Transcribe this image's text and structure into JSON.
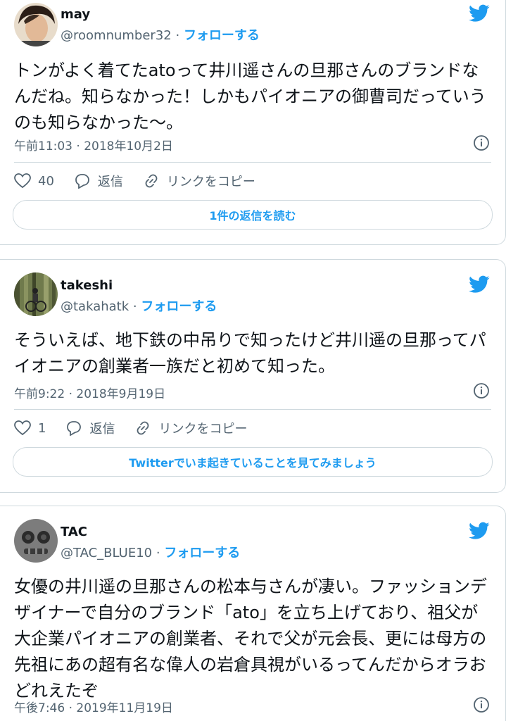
{
  "colors": {
    "accent": "#1d9bf0",
    "muted": "#536471",
    "border": "#cfd9de"
  },
  "tweets": [
    {
      "name": "may",
      "handle": "@roomnumber32",
      "dot": "·",
      "follow": "フォローする",
      "text": "トンがよく着てたatoって井川遥さんの旦那さんのブランドなんだね。知らなかった！しかもパイオニアの御曹司だっていうのも知らなかった〜。",
      "timestamp": "午前11:03 · 2018年10月2日",
      "likes": "40",
      "reply": "返信",
      "copy": "リンクをコピー",
      "cta": "1件の返信を読む"
    },
    {
      "name": "takeshi",
      "handle": "@takahatk",
      "dot": "·",
      "follow": "フォローする",
      "text": "そういえば、地下鉄の中吊りで知ったけど井川遥の旦那ってパイオニアの創業者一族だと初めて知った。",
      "timestamp": "午前9:22 · 2018年9月19日",
      "likes": "1",
      "reply": "返信",
      "copy": "リンクをコピー",
      "cta": "Twitterでいま起きていることを見てみましょう"
    },
    {
      "name": "TAC",
      "handle": "@TAC_BLUE10",
      "dot": "·",
      "follow": "フォローする",
      "text": "女優の井川遥の旦那さんの松本与さんが凄い。ファッションデザイナーで自分のブランド「ato」を立ち上げており、祖父が大企業パイオニアの創業者、それで父が元会長、更には母方の先祖にあの超有名な偉人の岩倉具視がいるってんだからオラおどれえたぞ",
      "timestamp": "午後7:46 · 2019年11月19日"
    }
  ]
}
